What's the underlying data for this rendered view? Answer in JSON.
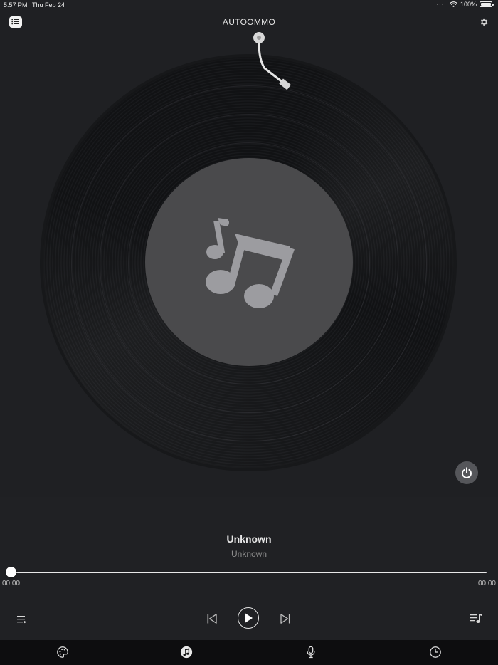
{
  "status_bar": {
    "time": "5:57 PM",
    "date": "Thu Feb 24",
    "battery": "100%",
    "icons": [
      "signal-dots-icon",
      "wifi-icon",
      "battery-icon"
    ]
  },
  "header": {
    "title": "AUTOOMMO",
    "left_icon": "list-icon",
    "right_icon": "gear-icon"
  },
  "player": {
    "album_art_icon": "music-notes-icon",
    "power_icon": "power-icon",
    "track_title": "Unknown",
    "track_artist": "Unknown",
    "progress": 0,
    "elapsed": "00:00",
    "total": "00:00"
  },
  "controls": {
    "queue_icon": "queue-icon",
    "previous_icon": "previous-icon",
    "play_icon": "play-icon",
    "next_icon": "next-icon",
    "playlist_icon": "playlist-icon"
  },
  "tab_bar": {
    "tabs": [
      {
        "icon": "palette-icon",
        "active": false
      },
      {
        "icon": "music-note-icon",
        "active": true
      },
      {
        "icon": "microphone-icon",
        "active": false
      },
      {
        "icon": "clock-icon",
        "active": false
      }
    ]
  },
  "colors": {
    "background": "#202124",
    "label": "#4a4a4c",
    "tab_bar": "#0d0d0f",
    "accent": "#ffffff"
  }
}
